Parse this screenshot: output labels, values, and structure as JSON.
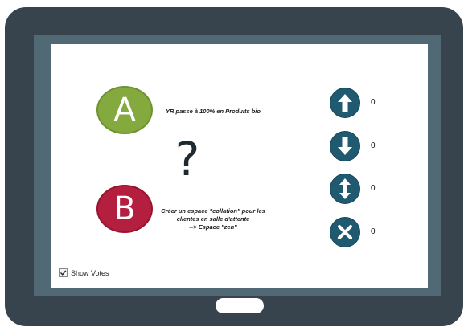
{
  "choices": [
    {
      "letter": "A",
      "text": "YR passe à 100% en Produits bio",
      "color": "#84a93e"
    },
    {
      "letter": "B",
      "text_lines": [
        "Créer un espace \"collation\" pour les",
        "clientes en salle d'attente",
        "--> Espace \"zen\""
      ],
      "color": "#b51f3f"
    }
  ],
  "question_mark": "?",
  "votes": [
    {
      "icon": "arrow-up-icon",
      "count": "0"
    },
    {
      "icon": "arrow-down-icon",
      "count": "0"
    },
    {
      "icon": "arrow-up-down-icon",
      "count": "0"
    },
    {
      "icon": "close-x-icon",
      "count": "0"
    }
  ],
  "show_votes": {
    "label": "Show Votes",
    "checked": true
  },
  "colors": {
    "tablet_frame": "#38444d",
    "bezel": "#516975",
    "vote_button": "#1f5a70"
  }
}
